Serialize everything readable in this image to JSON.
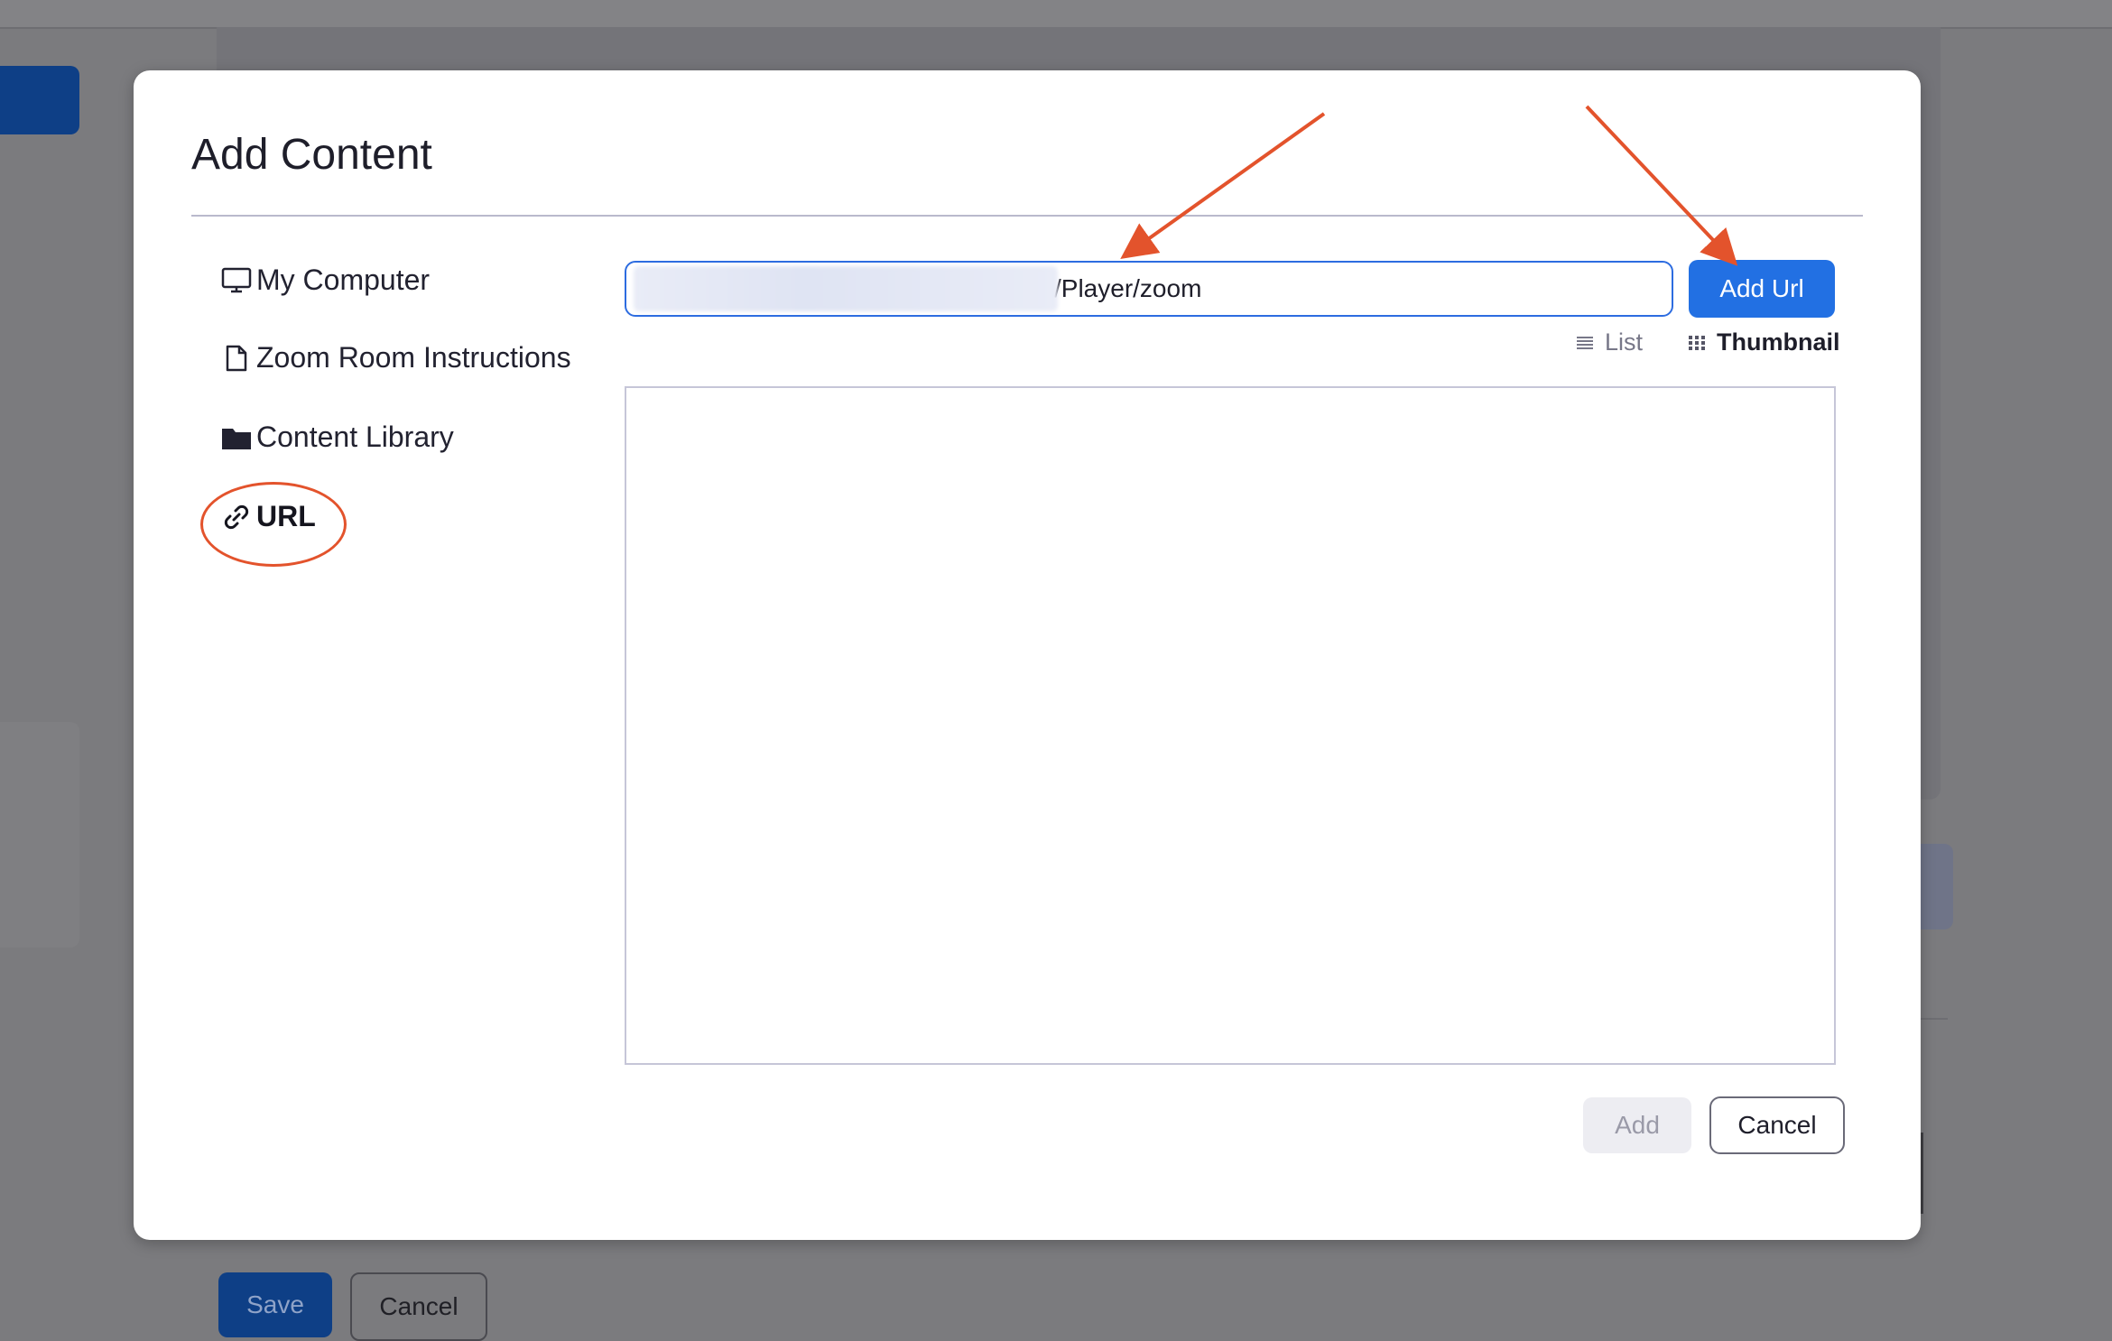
{
  "background": {
    "save_label": "Save",
    "cancel_label": "Cancel"
  },
  "modal": {
    "title": "Add Content",
    "nav": [
      {
        "label": "My Computer",
        "icon": "monitor-icon"
      },
      {
        "label": "Zoom Room Instructions",
        "icon": "file-icon"
      },
      {
        "label": "Content Library",
        "icon": "folder-icon"
      },
      {
        "label": "URL",
        "icon": "link-icon",
        "active": true
      }
    ],
    "url_input": {
      "value_visible_suffix": "/Player/zoom",
      "prefix_obscured": true
    },
    "add_url_label": "Add Url",
    "view": {
      "list_label": "List",
      "thumbnail_label": "Thumbnail",
      "selected": "Thumbnail"
    },
    "footer": {
      "add_label": "Add",
      "cancel_label": "Cancel",
      "add_enabled": false
    }
  },
  "colors": {
    "accent": "#2270e3",
    "annotation": "#e3532c",
    "overlay": "#7b7b7e"
  }
}
